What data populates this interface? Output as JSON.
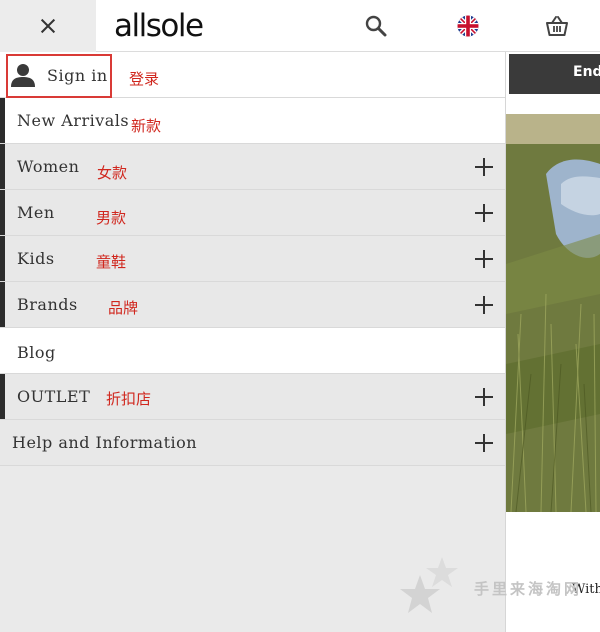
{
  "header": {
    "logo_text": "allsole",
    "close_icon": "close-icon",
    "search_icon": "search-icon",
    "flag_icon": "uk-flag-icon",
    "basket_icon": "basket-icon"
  },
  "menu": {
    "sign_in": {
      "label": "Sign in",
      "annotation": "登录",
      "icon": "person-icon"
    },
    "items": [
      {
        "label": "New Arrivals",
        "annotation": "新款",
        "expandable": false
      },
      {
        "label": "Women",
        "annotation": "女款",
        "expandable": true
      },
      {
        "label": "Men",
        "annotation": "男款",
        "expandable": true
      },
      {
        "label": "Kids",
        "annotation": "童鞋",
        "expandable": true
      },
      {
        "label": "Brands",
        "annotation": "品牌",
        "expandable": true
      },
      {
        "label": "Blog",
        "annotation": "",
        "expandable": false
      },
      {
        "label": "OUTLET",
        "annotation": "折扣店",
        "expandable": true
      },
      {
        "label": "Help and Information",
        "annotation": "",
        "expandable": true
      }
    ]
  },
  "content": {
    "banner_text": "End",
    "caption_text": "With"
  },
  "watermark": {
    "text": "手里来海淘网"
  },
  "colors": {
    "annotation_red": "#d0271e",
    "menu_grey": "#e8e8e8",
    "accent_dark": "#2c2c2c"
  }
}
